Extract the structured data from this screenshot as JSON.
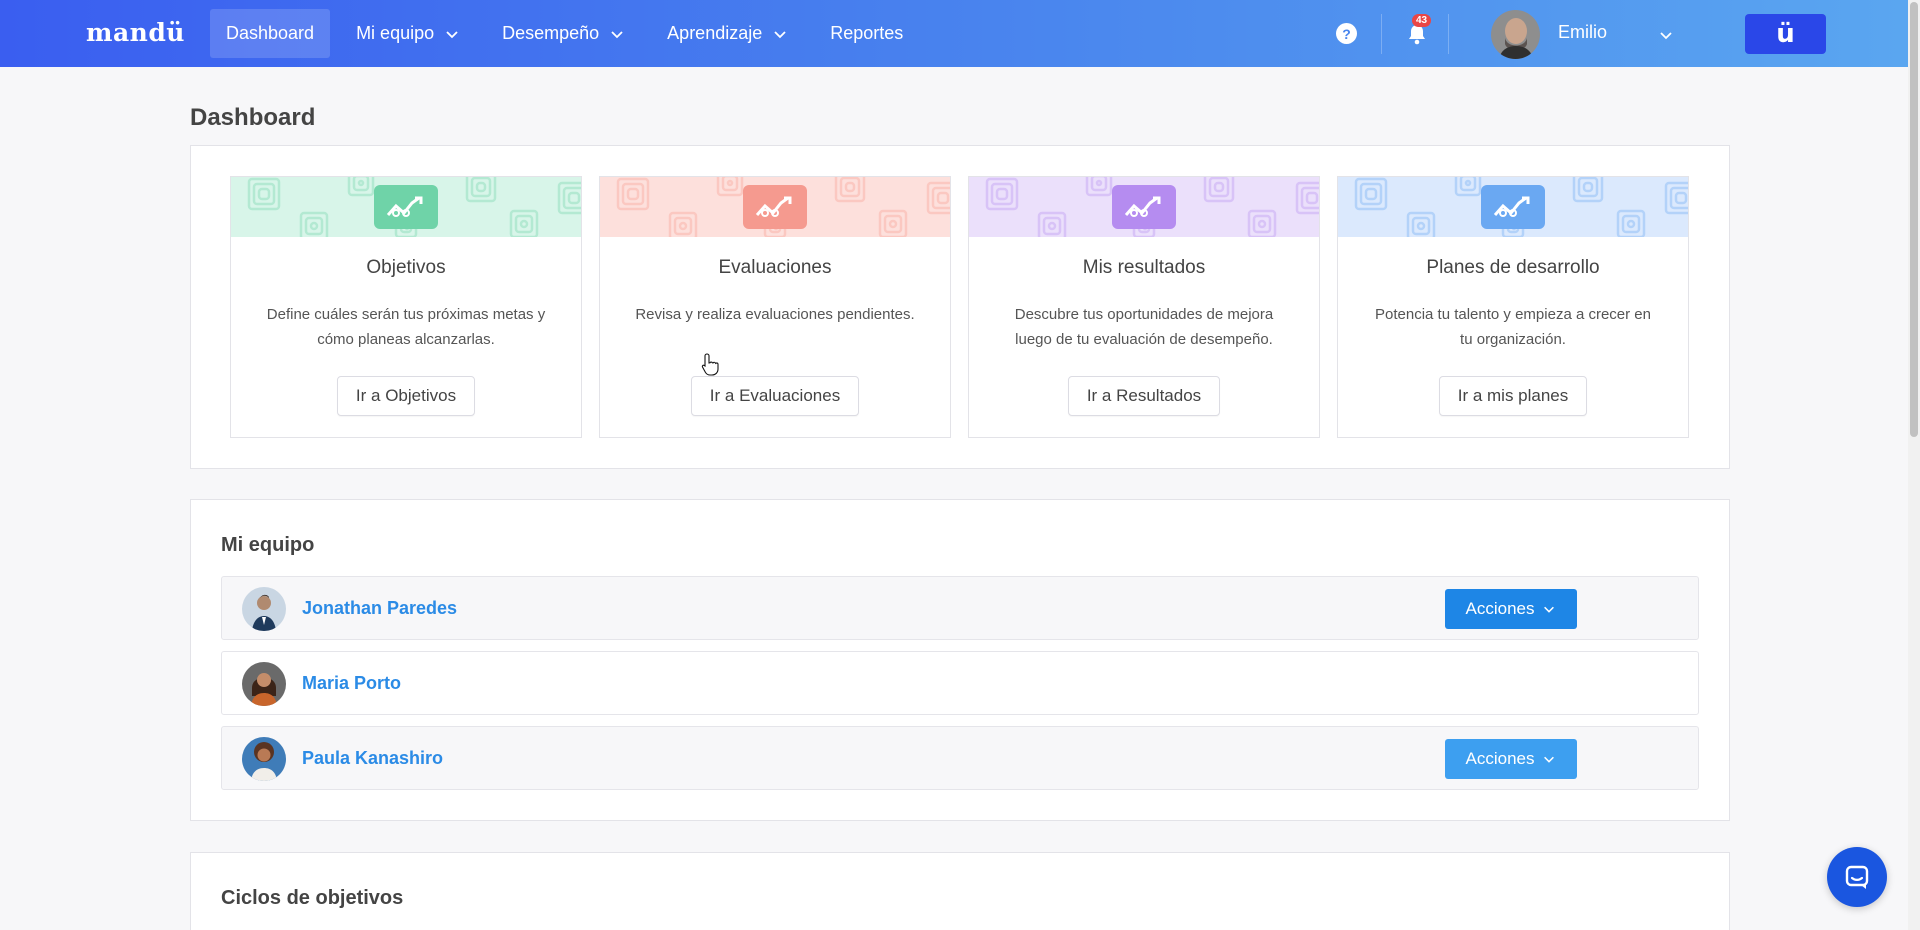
{
  "app": {
    "logo": "mandü",
    "brand_button": "ü"
  },
  "nav": {
    "items": [
      {
        "label": "Dashboard",
        "active": true,
        "dropdown": false
      },
      {
        "label": "Mi equipo",
        "active": false,
        "dropdown": true
      },
      {
        "label": "Desempeño",
        "active": false,
        "dropdown": true
      },
      {
        "label": "Aprendizaje",
        "active": false,
        "dropdown": true
      },
      {
        "label": "Reportes",
        "active": false,
        "dropdown": false
      }
    ]
  },
  "header": {
    "help_glyph": "?",
    "notifications_count": "43",
    "user_name": "Emilio"
  },
  "page": {
    "title": "Dashboard"
  },
  "cards": [
    {
      "title": "Objetivos",
      "description": "Define cuáles serán tus próximas metas y cómo planeas alcanzarlas.",
      "button": "Ir a Objetivos",
      "color": "#6fd3a8",
      "bg": "#d8f5e9"
    },
    {
      "title": "Evaluaciones",
      "description": "Revisa y realiza evaluaciones pendientes.",
      "button": "Ir a Evaluaciones",
      "color": "#f59a8f",
      "bg": "#fde0dc"
    },
    {
      "title": "Mis resultados",
      "description": "Descubre tus oportunidades de mejora luego de tu evaluación de desempeño.",
      "button": "Ir a Resultados",
      "color": "#b58cf0",
      "bg": "#ebe0fb"
    },
    {
      "title": "Planes de desarrollo",
      "description": "Potencia tu talento y empieza a crecer en tu organización.",
      "button": "Ir a mis planes",
      "color": "#6aa8f2",
      "bg": "#dbe9fd"
    }
  ],
  "team": {
    "title": "Mi equipo",
    "members": [
      {
        "name": "Jonathan Paredes",
        "actions": "Acciones"
      },
      {
        "name": "Maria Porto",
        "actions": ""
      },
      {
        "name": "Paula Kanashiro",
        "actions": "Acciones"
      }
    ]
  },
  "cycles": {
    "title": "Ciclos de objetivos"
  },
  "colors": {
    "primary": "#1e86e6",
    "link": "#2b8be6",
    "nav_start": "#3a5ef0",
    "nav_end": "#5aa6f0"
  }
}
